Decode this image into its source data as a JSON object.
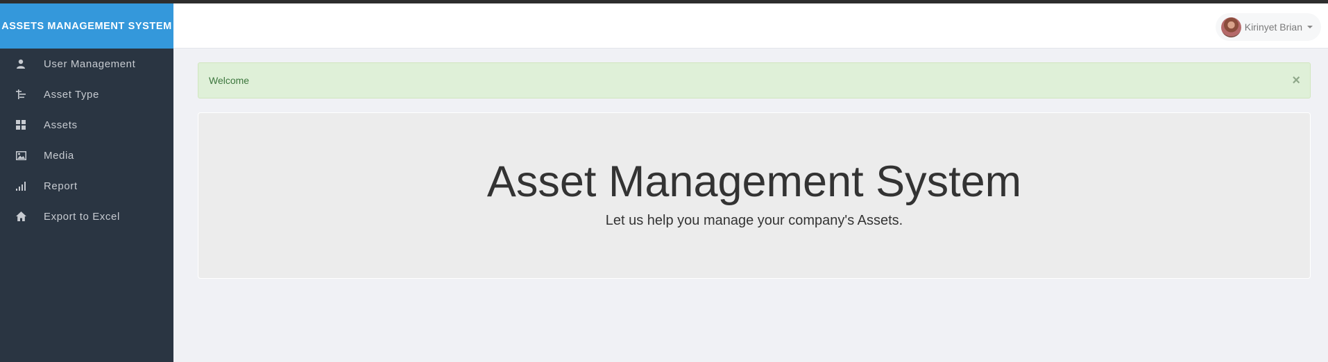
{
  "brand": {
    "title": "ASSETS MANAGEMENT SYSTEM"
  },
  "user": {
    "name": "Kirinyet Brian"
  },
  "sidebar": {
    "items": [
      {
        "label": "User Management",
        "icon": "user-icon"
      },
      {
        "label": "Asset Type",
        "icon": "tree-list-icon"
      },
      {
        "label": "Assets",
        "icon": "grid-icon"
      },
      {
        "label": "Media",
        "icon": "image-icon"
      },
      {
        "label": "Report",
        "icon": "signal-bars-icon"
      },
      {
        "label": "Export to Excel",
        "icon": "home-icon"
      }
    ]
  },
  "alert": {
    "message": "Welcome",
    "close_symbol": "×"
  },
  "hero": {
    "title": "Asset Management System",
    "subtitle": "Let us help you manage your company's Assets."
  },
  "colors": {
    "brand": "#3498db",
    "sidebar": "#2a3542",
    "alert_bg": "#dff0d8",
    "alert_text": "#3c763d",
    "page_bg": "#f0f1f5"
  }
}
